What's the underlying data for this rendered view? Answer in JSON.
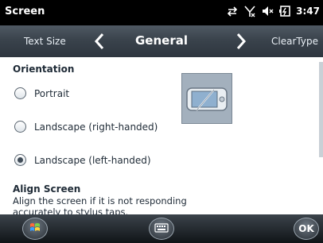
{
  "status_bar": {
    "title": "Screen",
    "time": "3:47",
    "icons": [
      "connectivity-icon",
      "signal-off-icon",
      "volume-muted-icon",
      "battery-icon"
    ]
  },
  "tab_bar": {
    "prev_label": "Text Size",
    "current_label": "General",
    "next_label": "ClearType"
  },
  "orientation": {
    "heading": "Orientation",
    "options": [
      {
        "label": "Portrait",
        "selected": false
      },
      {
        "label": "Landscape (right-handed)",
        "selected": false
      },
      {
        "label": "Landscape (left-handed)",
        "selected": true
      }
    ]
  },
  "align_screen": {
    "heading": "Align Screen",
    "description_line1": "Align the screen if it is not responding",
    "description_line2": "accurately to stylus taps."
  },
  "bottom_bar": {
    "start_icon": "windows-start-icon",
    "keyboard_icon": "keyboard-icon",
    "ok_label": "OK"
  }
}
